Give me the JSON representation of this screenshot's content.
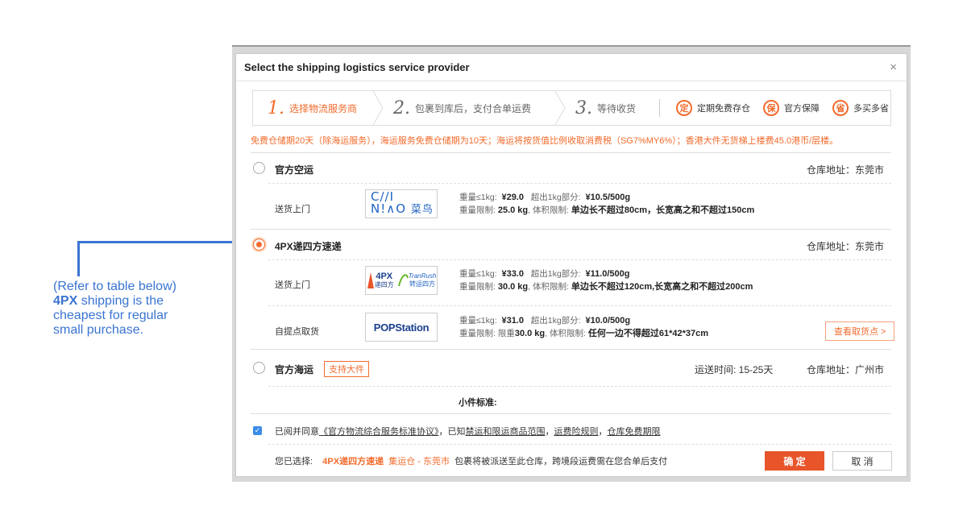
{
  "annotation": {
    "line1": "(Refer to table below)",
    "line2_bold": "4PX",
    "line2_rest": " shipping is the",
    "line3": "cheapest for regular",
    "line4": "small purchase."
  },
  "dialog": {
    "title": "Select the shipping logistics service provider",
    "close": "×"
  },
  "steps": [
    {
      "num": "1.",
      "label": "选择物流服务商"
    },
    {
      "num": "2.",
      "label": "包裹到库后，支付合单运费"
    },
    {
      "num": "3.",
      "label": "等待收货"
    }
  ],
  "badges": [
    {
      "char": "定",
      "label": "定期免费存仓"
    },
    {
      "char": "保",
      "label": "官方保障"
    },
    {
      "char": "省",
      "label": "多买多省"
    }
  ],
  "notice": "免费仓储期20天（除海运服务），海运服务免费仓储期为10天；海运将按货值比例收取消费税（SG7%MY6%）；香港大件无货梯上楼费45.0港币/层楼。",
  "options": {
    "air": {
      "title": "官方空运",
      "warehouse": "仓库地址：东莞市",
      "method": "送货上门",
      "logo_top": "C∕∕I",
      "logo_bottom": "N!∧O",
      "logo_cn": "菜鸟",
      "p1_label": "重量≤1kg:",
      "p1_val": "¥29.0",
      "p1_extra_label": "超出1kg部分:",
      "p1_extra_val": "¥10.5/500g",
      "p2_label": "重量限制:",
      "p2_val": "25.0 kg",
      "p2_vol_label": "体积限制:",
      "p2_vol_val": "单边长不超过80cm，长宽高之和不超过150cm"
    },
    "fourpx": {
      "title": "4PX递四方速递",
      "warehouse": "仓库地址：东莞市",
      "door": {
        "method": "送货上门",
        "logo_a": "4PX",
        "logo_a_cn": "递四方",
        "logo_b": "TranRush",
        "logo_b_cn": "转运四方",
        "p1_label": "重量≤1kg:",
        "p1_val": "¥33.0",
        "p1_extra_label": "超出1kg部分:",
        "p1_extra_val": "¥11.0/500g",
        "p2_label": "重量限制:",
        "p2_val": "30.0 kg",
        "p2_vol_label": "体积限制:",
        "p2_vol_val": "单边长不超过120cm,长宽高之和不超过200cm"
      },
      "pickup": {
        "method": "自提点取货",
        "logo": "POPStation",
        "p1_label": "重量≤1kg:",
        "p1_val": "¥31.0",
        "p1_extra_label": "超出1kg部分:",
        "p1_extra_val": "¥10.0/500g",
        "p2_label": "重量限制:",
        "p2_prefix": "限重",
        "p2_val": "30.0 kg",
        "p2_vol_label": "体积限制:",
        "p2_vol_val": "任何一边不得超过61*42*37cm",
        "button": "查看取货点 >"
      }
    },
    "sea": {
      "title": "官方海运",
      "tag": "支持大件",
      "transit": "运送时间: 15-25天",
      "warehouse": "仓库地址：广州市",
      "sub_label": "小件标准:"
    }
  },
  "agreement": {
    "prefix": "已阅并同意",
    "link1": "《官方物流综合服务标准协议》",
    "mid": "，已知",
    "link2": "禁运和限运商品范围",
    "sep": "，",
    "link3": "运费险规则",
    "sep2": "，",
    "link4": "仓库免费期限"
  },
  "selection": {
    "label": "您已选择:",
    "carrier": "4PX递四方速递",
    "warehouse": "集运仓 - 东莞市",
    "note": "包裹将被派送至此仓库，跨境段运费需在您合单后支付"
  },
  "buttons": {
    "confirm": "确 定",
    "cancel": "取 消"
  },
  "colors": {
    "accent": "#f26b2c",
    "annotation": "#3a74d2",
    "confirm_bg": "#e8552a"
  }
}
